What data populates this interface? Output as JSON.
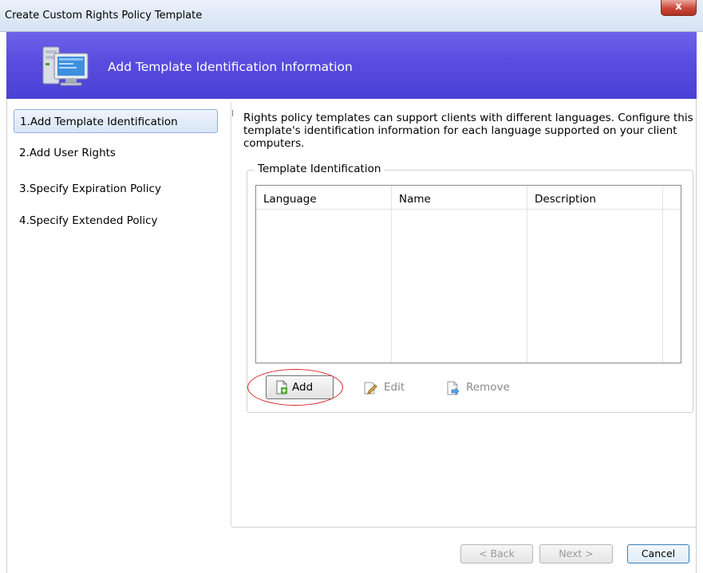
{
  "window": {
    "title": "Create Custom Rights Policy Template",
    "close_label": "x"
  },
  "banner": {
    "title": "Add Template Identification Information",
    "icon": "computer-monitor-icon"
  },
  "nav": {
    "items": [
      {
        "label": "1.Add Template Identification",
        "selected": true
      },
      {
        "label": "2.Add User Rights",
        "selected": false
      },
      {
        "label": "3.Specify Expiration Policy",
        "selected": false
      },
      {
        "label": "4.Specify Extended Policy",
        "selected": false
      }
    ]
  },
  "content": {
    "description": "Rights policy templates can support clients with different languages. Configure this template's identification information for each language supported on your client computers.",
    "group_label": "Template Identification",
    "table": {
      "columns": [
        "Language",
        "Name",
        "Description"
      ],
      "rows": []
    },
    "actions": {
      "add": "Add",
      "edit": "Edit",
      "remove": "Remove"
    }
  },
  "footer": {
    "back": "< Back",
    "next": "Next >",
    "cancel": "Cancel"
  },
  "colors": {
    "banner": "#5a4ee0",
    "highlight": "#d9262c",
    "selection_border": "#8fb0d8"
  }
}
